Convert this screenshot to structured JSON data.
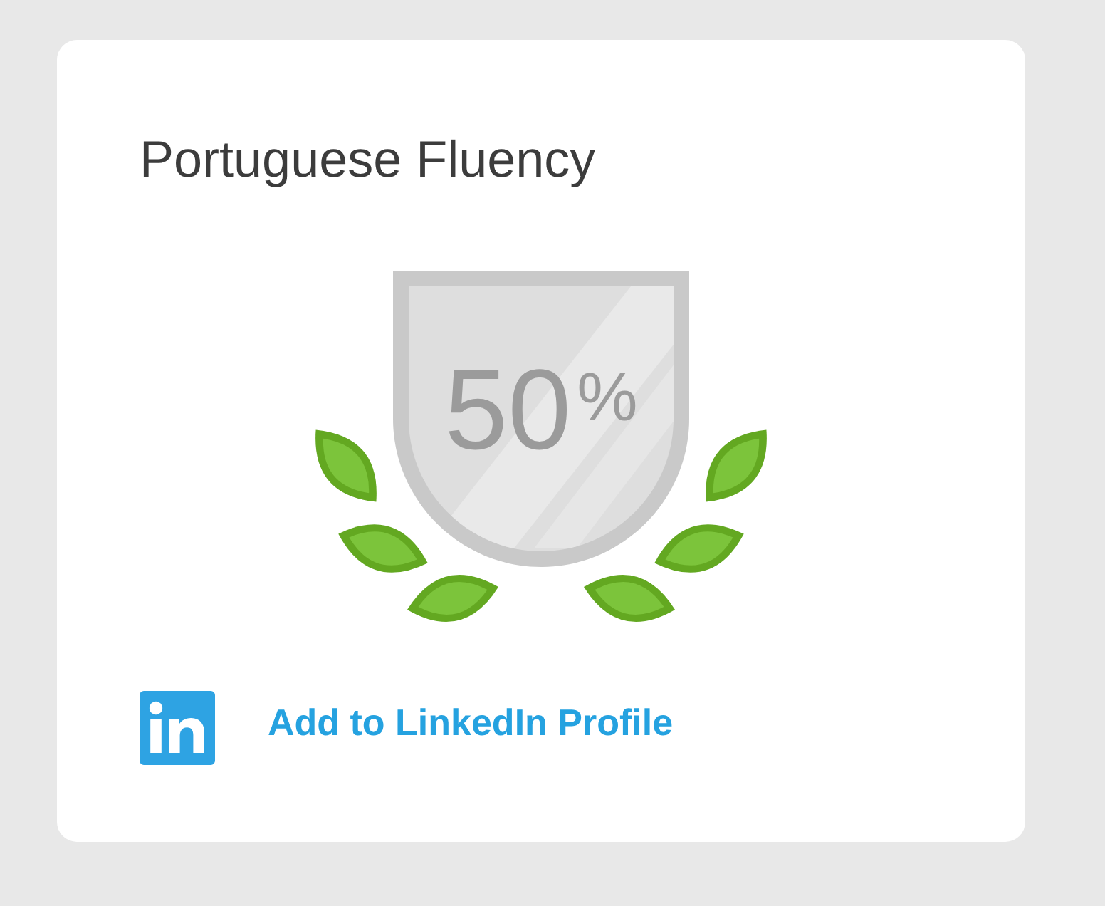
{
  "card": {
    "title": "Portuguese Fluency",
    "badge": {
      "text": "50$^{%}$"
    },
    "link": {
      "label": "Add to LinkedIn Profile"
    }
  }
}
